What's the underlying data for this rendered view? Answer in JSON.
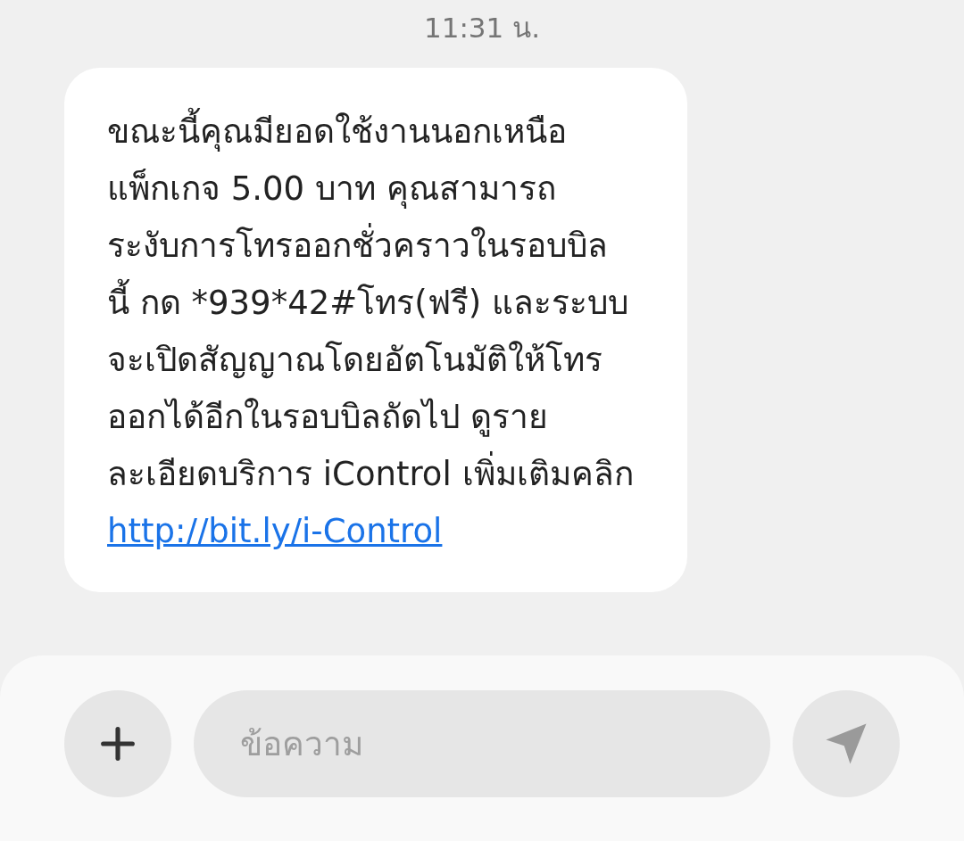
{
  "time": "11:31 น.",
  "messages": [
    {
      "text": "ขณะนี้คุณมียอดใช้งานนอกเหนือ\nแพ็กเกจ 5.00 บาท คุณสามารถ\nระงับการโทรออกชั่วคราวในรอบบิล\nนี้ กด *939*42#โทร(ฟรี) และระบบ\nจะเปิดสัญญาณโดยอัตโนมัติให้โทร\nออกได้อีกในรอบบิลถัดไป ดูราย\nละเอียดบริการ iControl เพิ่มเติมคลิก",
      "link": "http://bit.ly/i-Control"
    }
  ],
  "composer": {
    "placeholder": "ข้อความ"
  }
}
